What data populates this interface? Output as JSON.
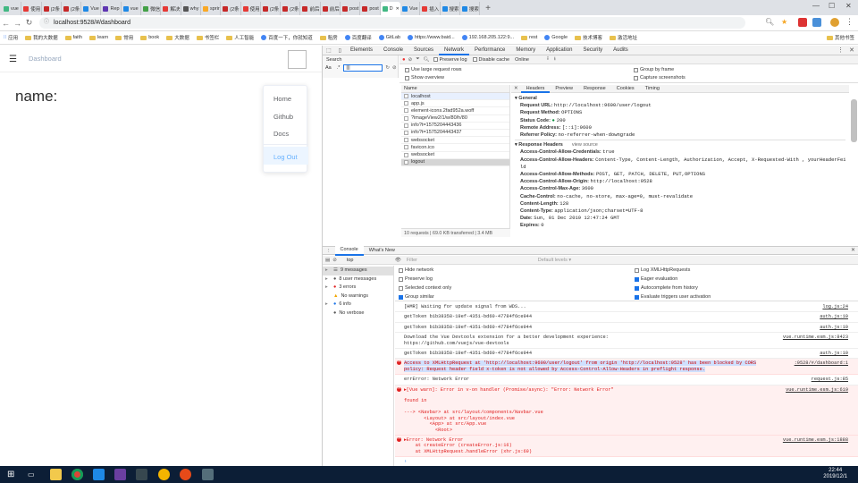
{
  "browser": {
    "tabs": [
      {
        "label": "vue",
        "color": "#41b883"
      },
      {
        "label": "使用",
        "color": "#e53935"
      },
      {
        "label": "(2条",
        "color": "#c62828"
      },
      {
        "label": "(2条",
        "color": "#c62828"
      },
      {
        "label": "Vue",
        "color": "#1e88e5"
      },
      {
        "label": "Rep",
        "color": "#5e35b1"
      },
      {
        "label": "vue",
        "color": "#1e88e5"
      },
      {
        "label": "微信",
        "color": "#43a047"
      },
      {
        "label": "解决",
        "color": "#e53935"
      },
      {
        "label": "why",
        "color": "#555555"
      },
      {
        "label": "sprir",
        "color": "#f9a825"
      },
      {
        "label": "(2条",
        "color": "#c62828"
      },
      {
        "label": "使用",
        "color": "#e53935"
      },
      {
        "label": "(2条",
        "color": "#c62828"
      },
      {
        "label": "(2条",
        "color": "#c62828"
      },
      {
        "label": "前后",
        "color": "#c62828"
      },
      {
        "label": "前后",
        "color": "#c62828"
      },
      {
        "label": "post",
        "color": "#c62828"
      },
      {
        "label": "post",
        "color": "#c62828"
      },
      {
        "label": "D",
        "color": "#41b883",
        "active": true
      },
      {
        "label": "Vue",
        "color": "#1e88e5"
      },
      {
        "label": "插入",
        "color": "#e53935"
      },
      {
        "label": "搜索",
        "color": "#1e88e5"
      },
      {
        "label": "搜索",
        "color": "#1e88e5"
      }
    ],
    "url": "localhost:9528/#/dashboard",
    "bookmarks": [
      {
        "label": "应用",
        "type": "apps"
      },
      {
        "label": "我的大数据",
        "type": "folder"
      },
      {
        "label": "faith",
        "type": "folder"
      },
      {
        "label": "learn",
        "type": "folder"
      },
      {
        "label": "常用",
        "type": "folder"
      },
      {
        "label": "book",
        "type": "folder"
      },
      {
        "label": "大数据",
        "type": "folder"
      },
      {
        "label": "书签栏",
        "type": "folder"
      },
      {
        "label": "人工智能",
        "type": "folder"
      },
      {
        "label": "百度一下，你就知道",
        "type": "site"
      },
      {
        "label": "租房",
        "type": "folder"
      },
      {
        "label": "百度翻译",
        "type": "site"
      },
      {
        "label": "GitLab",
        "type": "site"
      },
      {
        "label": "https://www.baid...",
        "type": "site"
      },
      {
        "label": "192.168.205.122:9...",
        "type": "site"
      },
      {
        "label": "rest",
        "type": "folder"
      },
      {
        "label": "Google",
        "type": "site"
      },
      {
        "label": "技术博客",
        "type": "folder"
      },
      {
        "label": "激活地址",
        "type": "folder"
      },
      {
        "label": "其他书签",
        "type": "folder"
      }
    ]
  },
  "app": {
    "breadcrumb": "Dashboard",
    "greeting": "name:",
    "menu": {
      "home": "Home",
      "github": "Github",
      "docs": "Docs",
      "logout": "Log Out"
    }
  },
  "devtools": {
    "tabs": [
      "Elements",
      "Console",
      "Sources",
      "Network",
      "Performance",
      "Memory",
      "Application",
      "Security",
      "Audits"
    ],
    "active_tab": "Network",
    "search_label": "Search",
    "filter_value": "|||",
    "toolbar": {
      "preserve_log": "Preserve log",
      "disable_cache": "Disable cache",
      "throttle": "Online"
    },
    "options": {
      "large_rows": "Use large request rows",
      "show_overview": "Show overview",
      "group_by_frame": "Group by frame",
      "capture_screenshots": "Capture screenshots"
    },
    "name_header": "Name",
    "requests": [
      "localhost",
      "app.js",
      "element-icons.2fad952a.woff",
      "?imageView2/1/w/80/h/80",
      "info?t=1575204443436",
      "info?t=1575204443437",
      "websocket",
      "favicon.ico",
      "websocket",
      "logout"
    ],
    "summary": {
      "requests": "10 requests",
      "transferred": "69.0 KB transferred",
      "size": "3.4 MB"
    },
    "detail_tabs": [
      "Headers",
      "Preview",
      "Response",
      "Cookies",
      "Timing"
    ],
    "general_title": "General",
    "general": [
      {
        "k": "Request URL:",
        "v": "http://localhost:9600/user/logout"
      },
      {
        "k": "Request Method:",
        "v": "OPTIONS"
      },
      {
        "k": "Status Code:",
        "v": "200"
      },
      {
        "k": "Remote Address:",
        "v": "[::1]:9600"
      },
      {
        "k": "Referrer Policy:",
        "v": "no-referrer-when-downgrade"
      }
    ],
    "response_title": "Response Headers",
    "view_source": "view source",
    "response": [
      {
        "k": "Access-Control-Allow-Credentials:",
        "v": "true"
      },
      {
        "k": "Access-Control-Allow-Headers:",
        "v": "Content-Type, Content-Length, Authorization, Accept, X-Requested-With , yourHeaderFeild"
      },
      {
        "k": "",
        "v": "ld"
      },
      {
        "k": "Access-Control-Allow-Methods:",
        "v": "POST, GET, PATCH, DELETE, PUT,OPTIONS"
      },
      {
        "k": "Access-Control-Allow-Origin:",
        "v": "http://localhost:9528"
      },
      {
        "k": "Access-Control-Max-Age:",
        "v": "3600"
      },
      {
        "k": "Cache-Control:",
        "v": "no-cache, no-store, max-age=0, must-revalidate"
      },
      {
        "k": "Content-Length:",
        "v": "128"
      },
      {
        "k": "Content-Type:",
        "v": "application/json;charset=UTF-8"
      },
      {
        "k": "Date:",
        "v": "Sun, 01 Dec 2019 12:47:24 GMT"
      },
      {
        "k": "Expires:",
        "v": "0"
      }
    ],
    "drawer_tabs": [
      "Console",
      "What's New"
    ],
    "context": "top",
    "console_filter_placeholder": "Filter",
    "levels": "Default levels ▾",
    "console_sidebar": [
      {
        "label": "9 messages",
        "icon": "list"
      },
      {
        "label": "8 user messages",
        "icon": "user"
      },
      {
        "label": "3 errors",
        "icon": "error"
      },
      {
        "label": "No warnings",
        "icon": "warning"
      },
      {
        "label": "6 info",
        "icon": "info"
      },
      {
        "label": "No verbose",
        "icon": "verbose"
      }
    ],
    "console_settings": [
      {
        "label": "Hide network",
        "on": false
      },
      {
        "label": "Log XMLHttpRequests",
        "on": false
      },
      {
        "label": "Preserve log",
        "on": false
      },
      {
        "label": "Eager evaluation",
        "on": true
      },
      {
        "label": "Selected context only",
        "on": false
      },
      {
        "label": "Autocomplete from history",
        "on": true
      },
      {
        "label": "Group similar",
        "on": true
      },
      {
        "label": "Evaluate triggers user activation",
        "on": true
      }
    ],
    "console_lines": [
      {
        "text": "[HMR] Waiting for update signal from WDS...",
        "src": "log.js:24",
        "err": false
      },
      {
        "text": "getToken b1b38358-19ef-4351-bd60-47784f6ce944",
        "src": "auth.js:10",
        "err": false
      },
      {
        "text": "getToken b1b38358-19ef-4351-bd60-47784f6ce944",
        "src": "auth.js:10",
        "err": false
      },
      {
        "text": "Download the Vue Devtools extension for a better development experience:\nhttps://github.com/vuejs/vue-devtools",
        "src": "vue.runtime.esm.js:8423",
        "err": false
      },
      {
        "text": "getToken b1b38358-19ef-4351-bd60-47784f6ce944",
        "src": "auth.js:10",
        "err": false
      },
      {
        "text": "Access to XMLHttpRequest at 'http://localhost:9600/user/logout' from origin 'http://localhost:9528' has been blocked by CORS\npolicy: Request header field x-token is not allowed by Access-Control-Allow-Headers in preflight response.",
        "src": ":9528/#/dashboard:1",
        "err": true
      },
      {
        "text": "errError: Network Error",
        "src": "request.js:85",
        "err": false
      },
      {
        "text": "▸[Vue warn]: Error in v-on handler (Promise/async): \"Error: Network Error\"\n\nfound in\n\n---> <Navbar> at src/layout/components/Navbar.vue\n       <Layout> at src/layout/index.vue\n         <App> at src/App.vue\n           <Root>",
        "src": "vue.runtime.esm.js:619",
        "err": true
      },
      {
        "text": "▸Error: Network Error\n    at createError (createError.js:16)\n    at XMLHttpRequest.handleError (xhr.js:69)",
        "src": "vue.runtime.esm.js:1888",
        "err": true
      }
    ],
    "prompt": "›"
  },
  "taskbar": {
    "time": "22:44",
    "date": "2019/12/1"
  }
}
